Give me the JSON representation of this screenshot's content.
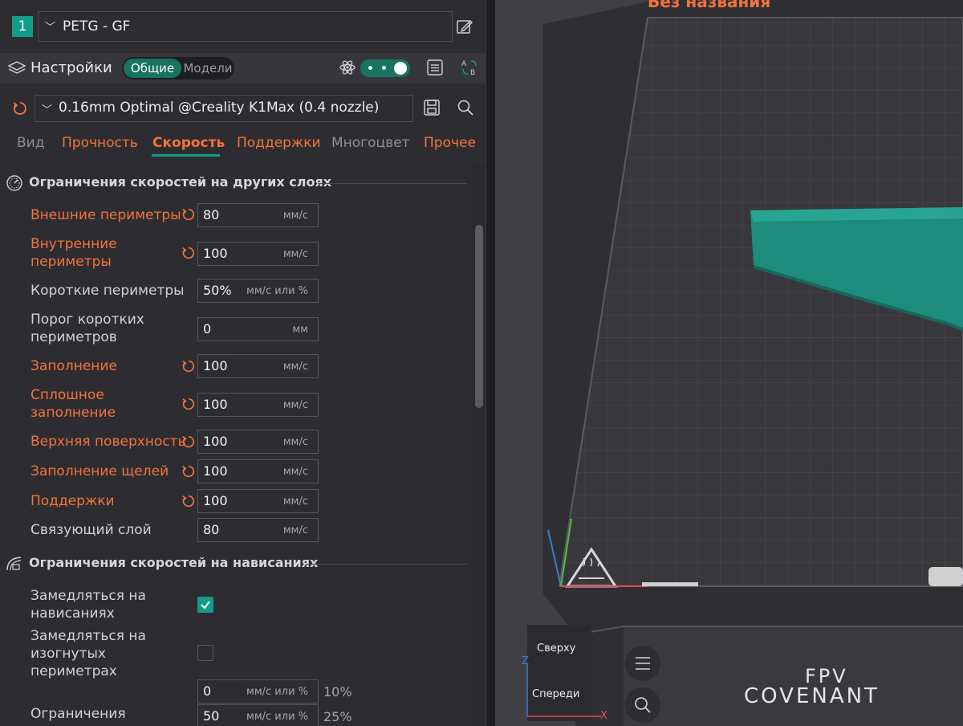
{
  "filament": {
    "extruder_index": "1",
    "name": "PETG - GF"
  },
  "settings_bar": {
    "title": "Настройки",
    "mode_on": "Общие",
    "mode_off": "Модели"
  },
  "preset": {
    "name": "0.16mm Optimal @Creality K1Max (0.4 nozzle)"
  },
  "tabs": [
    {
      "label": "Вид",
      "state": "dim"
    },
    {
      "label": "Прочность",
      "state": "warn"
    },
    {
      "label": "Скорость",
      "state": "active"
    },
    {
      "label": "Поддержки",
      "state": "warn"
    },
    {
      "label": "Многоцвет",
      "state": "dim"
    },
    {
      "label": "Прочее",
      "state": "warn"
    }
  ],
  "sections": {
    "other_layers": "Ограничения скоростей на других слоях",
    "overhangs": "Ограничения скоростей на нависаниях"
  },
  "speed_rows": [
    {
      "label": "Внешние периметры",
      "value": "80",
      "unit": "мм/с",
      "modified": true
    },
    {
      "label": "Внутренние периметры",
      "value": "100",
      "unit": "мм/с",
      "modified": true
    },
    {
      "label": "Короткие периметры",
      "value": "50%",
      "unit": "мм/с или %",
      "modified": false
    },
    {
      "label": "Порог коротких периметров",
      "value": "0",
      "unit": "мм",
      "modified": false
    },
    {
      "label": "Заполнение",
      "value": "100",
      "unit": "мм/с",
      "modified": true
    },
    {
      "label": "Сплошное заполнение",
      "value": "100",
      "unit": "мм/с",
      "modified": true
    },
    {
      "label": "Верхняя поверхность",
      "value": "100",
      "unit": "мм/с",
      "modified": true
    },
    {
      "label": "Заполнение щелей",
      "value": "100",
      "unit": "мм/с",
      "modified": true
    },
    {
      "label": "Поддержки",
      "value": "100",
      "unit": "мм/с",
      "modified": true
    },
    {
      "label": "Связующий слой",
      "value": "80",
      "unit": "мм/с",
      "modified": false
    }
  ],
  "overhang_rows": {
    "slow_down_label": "Замедляться на нависаниях",
    "slow_down_checked": true,
    "curled_label": "Замедляться на изогнутых периметрах",
    "curled_checked": false,
    "row1_value": "0",
    "row1_unit": "мм/с или %",
    "row1_extra": "10%",
    "row2_label": "Ограничения",
    "row2_value": "50",
    "row2_unit": "мм/с или %",
    "row2_extra": "25%"
  },
  "viewport": {
    "plate_title": "Без названия",
    "cube_top": "Сверху",
    "cube_front": "Спереди",
    "axis_z": "Z",
    "axis_x": "X",
    "brand_line1": "FPV",
    "brand_line2": "COVENANT"
  },
  "colors": {
    "accent": "#139c86",
    "modified": "#f4733c",
    "model": "#1e8c7c"
  }
}
